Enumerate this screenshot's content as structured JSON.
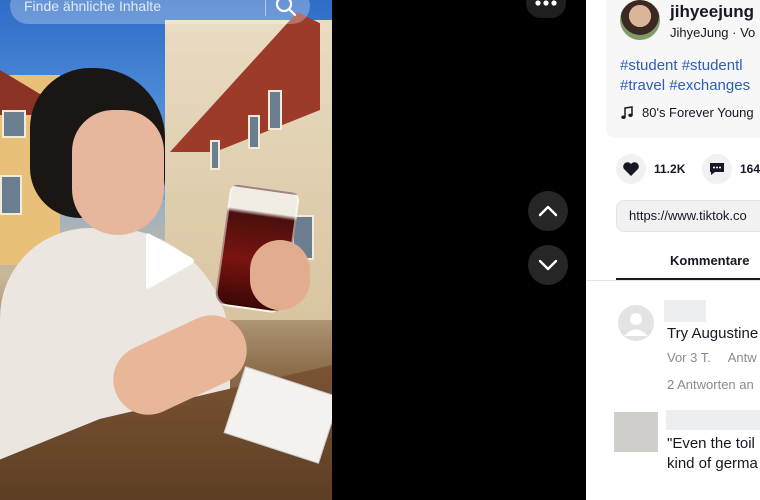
{
  "search": {
    "placeholder": "Finde ähnliche Inhalte",
    "icon": "search-icon"
  },
  "video": {
    "play_icon": "play-icon"
  },
  "controls": {
    "more_icon": "more-icon",
    "up_icon": "chevron-up-icon",
    "down_icon": "chevron-down-icon"
  },
  "author": {
    "username": "jihyeejung",
    "display_line": "JihyeJung · Vo"
  },
  "description": {
    "tags_line1": "#student #studentl",
    "tags_line2": "#travel #exchanges"
  },
  "music": {
    "title": "80's Forever Young"
  },
  "actions": {
    "likes": "11.2K",
    "comments": "164"
  },
  "link": {
    "url": "https://www.tiktok.co"
  },
  "tabs": {
    "comments_label": "Kommentare"
  },
  "comments": [
    {
      "text": "Try Augustine",
      "time": "Vor 3 T.",
      "reply": "Antw",
      "replies": "2 Antworten an"
    },
    {
      "line1": "\"Even the toil",
      "line2": "kind of germa"
    }
  ],
  "colors": {
    "accent_tag": "#2b5db9",
    "text": "#161823",
    "muted": "#8a8b91"
  }
}
